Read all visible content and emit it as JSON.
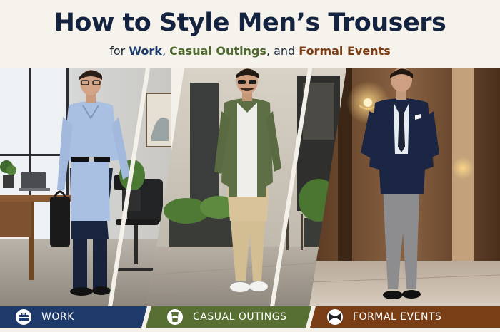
{
  "header": {
    "title": "How to Style Men’s Trousers",
    "subtitle_prefix": "for ",
    "subtitle_work": "Work",
    "subtitle_sep1": ", ",
    "subtitle_casual": "Casual Outings",
    "subtitle_sep2": ", and ",
    "subtitle_formal": "Formal Events"
  },
  "panels": [
    {
      "id": "work",
      "label": "WORK",
      "icon": "briefcase-icon",
      "color": "#1e3a6a"
    },
    {
      "id": "casual",
      "label": "CASUAL OUTINGS",
      "icon": "coffee-cup-icon",
      "color": "#586f33"
    },
    {
      "id": "formal",
      "label": "FORMAL EVENTS",
      "icon": "bow-tie-icon",
      "color": "#7a3e17"
    }
  ]
}
